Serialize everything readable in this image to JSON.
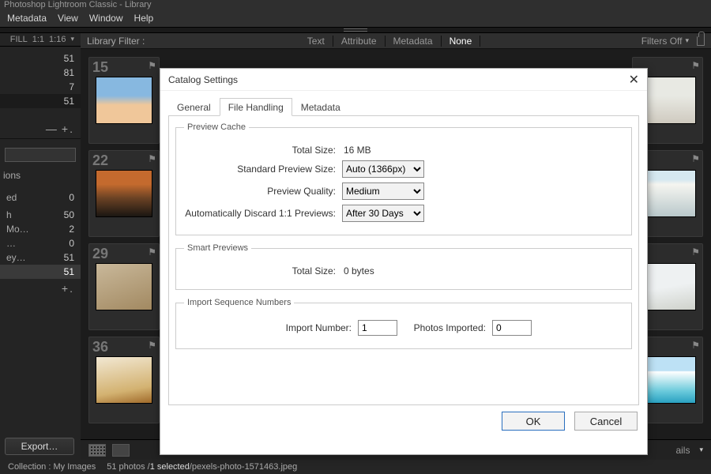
{
  "app": {
    "title": "Photoshop Lightroom Classic - Library"
  },
  "menu": {
    "metadata": "Metadata",
    "view": "View",
    "window": "Window",
    "help": "Help"
  },
  "zoom": {
    "fill": "FILL",
    "one": "1:1",
    "two": "1:16"
  },
  "filterbar": {
    "label": "Library Filter :",
    "text": "Text",
    "attribute": "Attribute",
    "metadata": "Metadata",
    "none": "None",
    "filtersoff": "Filters Off"
  },
  "left": {
    "counts1": [
      "51",
      "81",
      "7",
      "51"
    ],
    "catalog": "…",
    "collections": "ions",
    "rows": [
      {
        "label": "ed",
        "count": "0"
      },
      {
        "label": "",
        "count": ""
      },
      {
        "label": "h",
        "count": "50"
      },
      {
        "label": "Mo…",
        "count": "2"
      },
      {
        "label": "…",
        "count": "0"
      },
      {
        "label": "ey…",
        "count": "51"
      },
      {
        "label": "",
        "count": "51"
      }
    ],
    "export": "Export…"
  },
  "thumbs": {
    "nums": [
      "15",
      "22",
      "29",
      "36"
    ]
  },
  "bottombarRight": "ails",
  "status": {
    "collection": "Collection : My Images",
    "count": "51 photos /",
    "selected": "1 selected",
    "path": " /pexels-photo-1571463.jpeg"
  },
  "dialog": {
    "title": "Catalog Settings",
    "tabs": {
      "general": "General",
      "file": "File Handling",
      "meta": "Metadata"
    },
    "preview": {
      "legend": "Preview Cache",
      "totalSizeLabel": "Total Size:",
      "totalSize": "16 MB",
      "stdLabel": "Standard Preview Size:",
      "stdValue": "Auto (1366px)",
      "qualityLabel": "Preview Quality:",
      "qualityValue": "Medium",
      "discardLabel": "Automatically Discard 1:1 Previews:",
      "discardValue": "After 30 Days"
    },
    "smart": {
      "legend": "Smart Previews",
      "totalSizeLabel": "Total Size:",
      "totalSize": "0 bytes"
    },
    "import": {
      "legend": "Import Sequence Numbers",
      "numLabel": "Import Number:",
      "numValue": "1",
      "photosLabel": "Photos Imported:",
      "photosValue": "0"
    },
    "ok": "OK",
    "cancel": "Cancel"
  }
}
